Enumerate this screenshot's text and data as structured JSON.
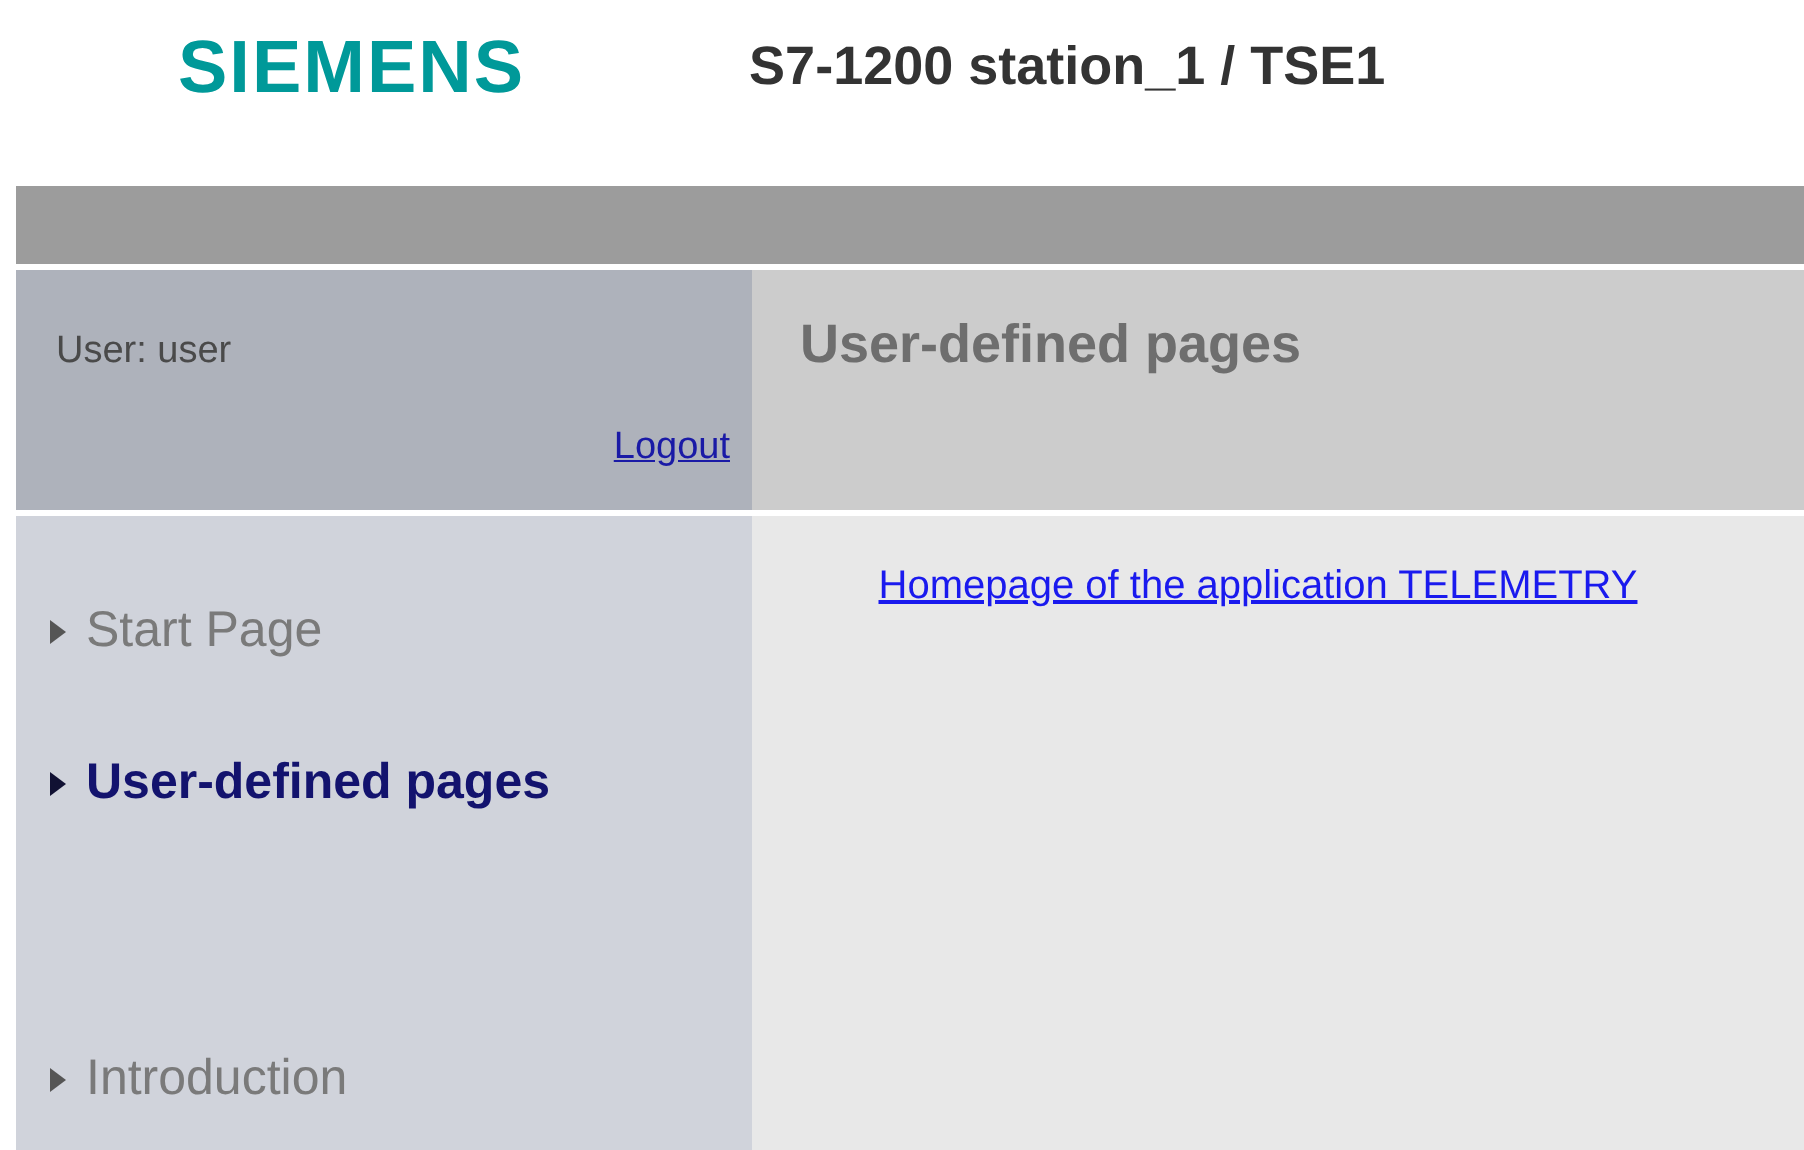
{
  "header": {
    "logo": "SIEMENS",
    "station": "S7-1200 station_1 / TSE1"
  },
  "user_box": {
    "user_label": "User: user",
    "logout": "Logout"
  },
  "sidebar": {
    "items": [
      {
        "label": "Start Page",
        "selected": false
      },
      {
        "label": "User-defined pages",
        "selected": true
      },
      {
        "label": "Introduction",
        "selected": false
      }
    ]
  },
  "content": {
    "title": "User-defined pages",
    "link": "Homepage of the application TELEMETRY"
  }
}
